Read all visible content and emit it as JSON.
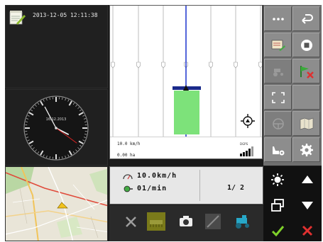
{
  "status": {
    "datetime": "2013-12-05 12:11:38",
    "clock_date": "16.12.2013",
    "clock_time": {
      "hour": 3,
      "minute": 55,
      "second": 21
    }
  },
  "field": {
    "speed": "10.0 km/h",
    "area": "0.00 ha",
    "gps_label": "DGPS",
    "gps_signal_bars": 4
  },
  "readout": {
    "speed_value": "10.0km/h",
    "rpm_value": "01/min",
    "page": "1/ 2"
  },
  "softkeys": [
    {
      "name": "more-menu-key",
      "icon": "ellipsis-icon"
    },
    {
      "name": "back-key",
      "icon": "undo-arrow-icon"
    },
    {
      "name": "field-data-key",
      "icon": "document-edit-icon"
    },
    {
      "name": "stop-key",
      "icon": "stop-circle-icon"
    },
    {
      "name": "tractor-disabled-key",
      "icon": "tractor-icon"
    },
    {
      "name": "clear-boundary-key",
      "icon": "flag-cross-icon"
    },
    {
      "name": "zoom-fit-key",
      "icon": "expand-corners-icon"
    },
    {
      "name": "empty-key",
      "icon": ""
    },
    {
      "name": "wheel-disabled-key",
      "icon": "steering-wheel-icon"
    },
    {
      "name": "map-view-key",
      "icon": "map-icon"
    },
    {
      "name": "implement-settings-key",
      "icon": "implement-gear-icon"
    },
    {
      "name": "settings-key",
      "icon": "gear-icon"
    }
  ],
  "toolbar": [
    {
      "name": "tools-button",
      "icon": "tools-icon"
    },
    {
      "name": "implement-button",
      "icon": "implement-icon"
    },
    {
      "name": "camera-button",
      "icon": "camera-icon"
    },
    {
      "name": "guidance-button",
      "icon": "guidance-icon"
    },
    {
      "name": "tractor-button",
      "icon": "tractor-icon"
    }
  ],
  "nav": [
    {
      "name": "brightness-button",
      "icon": "sun-icon"
    },
    {
      "name": "arrow-up-button",
      "icon": "arrow-up-icon"
    },
    {
      "name": "window-switch-button",
      "icon": "windows-icon"
    },
    {
      "name": "arrow-down-button",
      "icon": "arrow-down-icon"
    },
    {
      "name": "confirm-button",
      "icon": "check-icon"
    },
    {
      "name": "cancel-button",
      "icon": "close-icon"
    }
  ],
  "colors": {
    "coverage_green": "#7de27a",
    "guide_line_blue": "#2a3fd0",
    "confirm_green": "#7fd12a",
    "cancel_red": "#e03030",
    "second_hand_red": "#d02020"
  }
}
